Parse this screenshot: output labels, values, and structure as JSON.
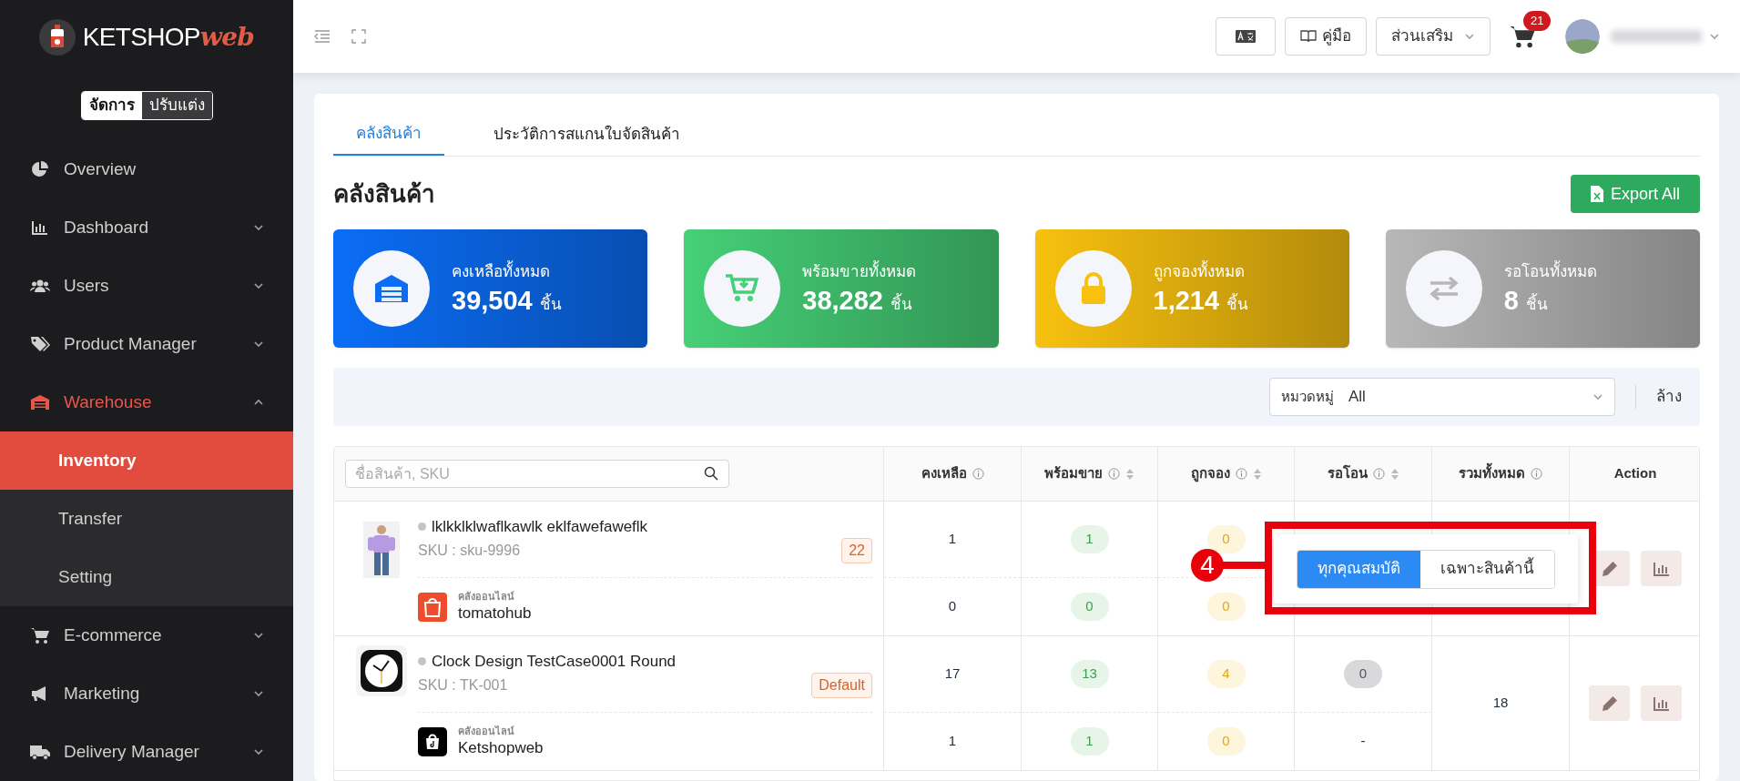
{
  "sidebar": {
    "logo": {
      "text": "KETSHOP",
      "accent": "web"
    },
    "mode_toggle": [
      {
        "label": "จัดการ",
        "selected": true
      },
      {
        "label": "ปรับแต่ง",
        "selected": false
      }
    ],
    "items": [
      {
        "label": "Overview",
        "kind": "link",
        "selected": false
      },
      {
        "label": "Dashboard",
        "kind": "group",
        "selected": false,
        "expanded": false
      },
      {
        "label": "Users",
        "kind": "group",
        "selected": false,
        "expanded": false
      },
      {
        "label": "Product Manager",
        "kind": "group",
        "selected": false,
        "expanded": false
      },
      {
        "label": "Warehouse",
        "kind": "group",
        "selected": true,
        "expanded": true,
        "children": [
          {
            "label": "Inventory",
            "selected": true
          },
          {
            "label": "Transfer",
            "selected": false
          },
          {
            "label": "Setting",
            "selected": false
          }
        ]
      },
      {
        "label": "E-commerce",
        "kind": "group",
        "selected": false,
        "expanded": false
      },
      {
        "label": "Marketing",
        "kind": "group",
        "selected": false,
        "expanded": false
      },
      {
        "label": "Delivery Manager",
        "kind": "group",
        "selected": false,
        "expanded": false
      }
    ]
  },
  "header": {
    "manual_button": "คู่มือ",
    "addons_dropdown": "ส่วนเสริม",
    "cart_badge": "21"
  },
  "tabs": [
    {
      "label": "คลังสินค้า",
      "selected": true
    },
    {
      "label": "ประวัติการสแกนใบจัดสินค้า",
      "selected": false
    }
  ],
  "page_title": "คลังสินค้า",
  "export_button": "Export All",
  "stats": [
    {
      "label": "คงเหลือทั้งหมด",
      "value": "39,504",
      "unit": "ชิ้น",
      "color": "#0b6df6"
    },
    {
      "label": "พร้อมขายทั้งหมด",
      "value": "38,282",
      "unit": "ชิ้น",
      "color": "#46d077"
    },
    {
      "label": "ถูกจองทั้งหมด",
      "value": "1,214",
      "unit": "ชิ้น",
      "color": "#f8c10f"
    },
    {
      "label": "รอโอนทั้งหมด",
      "value": "8",
      "unit": "ชิ้น",
      "color": "#b8b8b8"
    }
  ],
  "filter": {
    "label": "หมวดหมู่",
    "value": "All",
    "clear_button": "ล้าง"
  },
  "table": {
    "search_placeholder": "ชื่อสินค้า, SKU",
    "columns": [
      {
        "label": "คงเหลือ",
        "info": true,
        "sortable": false
      },
      {
        "label": "พร้อมขาย",
        "info": true,
        "sortable": true
      },
      {
        "label": "ถูกจอง",
        "info": true,
        "sortable": true
      },
      {
        "label": "รอโอน",
        "info": true,
        "sortable": true
      },
      {
        "label": "รวมทั้งหมด",
        "info": true,
        "sortable": false
      },
      {
        "label": "Action",
        "info": false,
        "sortable": false
      }
    ],
    "rows": [
      {
        "name": "lklkklklwaflkawlk eklfawefaweflk",
        "sku": "SKU : sku-9996",
        "tag": "22",
        "remaining": "1",
        "ready": "1",
        "reserved": "0",
        "channel": {
          "label": "คลังออนไลน์",
          "name": "tomatohub",
          "remaining": "0",
          "ready": "0",
          "reserved": "0"
        }
      },
      {
        "name": "Clock Design TestCase0001 Round",
        "sku": "SKU : TK-001",
        "tag": "Default",
        "remaining": "17",
        "ready": "13",
        "reserved": "4",
        "pending": "0",
        "total": "18",
        "channel": {
          "label": "คลังออนไลน์",
          "name": "Ketshopweb",
          "remaining": "1",
          "ready": "1",
          "reserved": "0",
          "pending": "-"
        }
      }
    ]
  },
  "popover": {
    "options": [
      {
        "label": "ทุกคุณสมบัติ",
        "selected": true
      },
      {
        "label": "เฉพาะสินค้านี้",
        "selected": false
      }
    ]
  },
  "annotation": {
    "step": "4"
  }
}
